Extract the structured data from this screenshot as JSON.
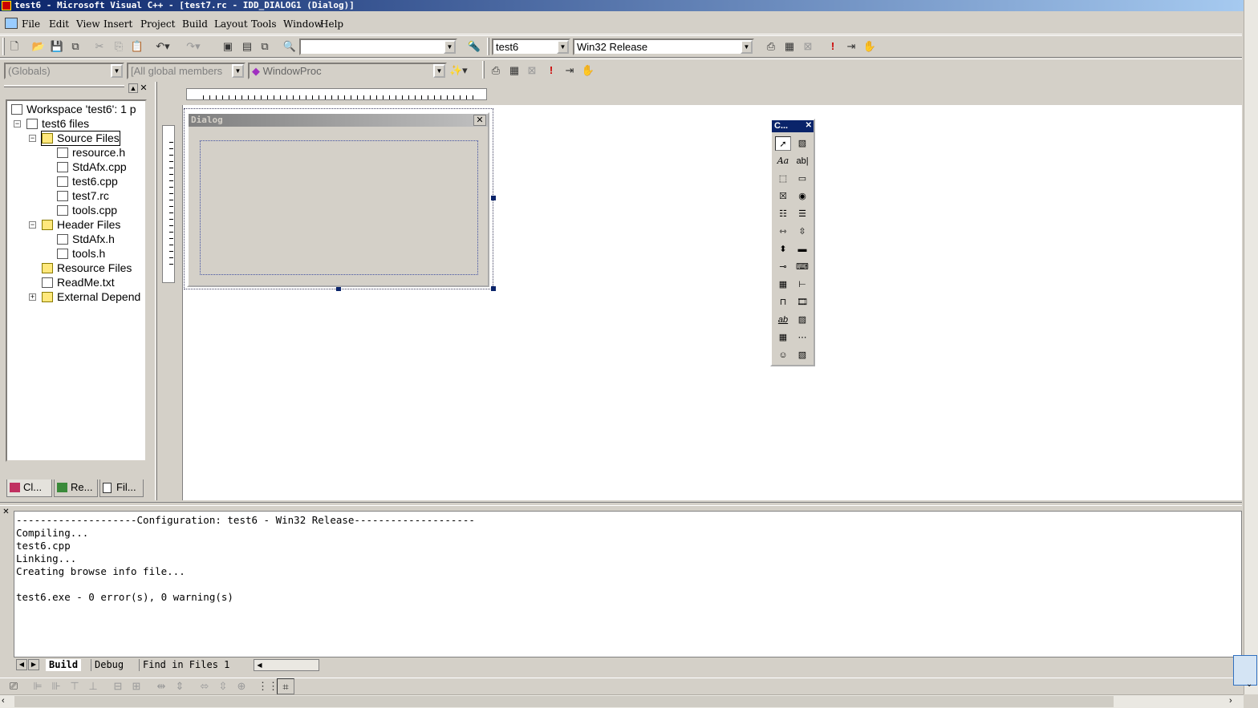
{
  "window": {
    "title": "test6 - Microsoft Visual C++ - [test7.rc - IDD_DIALOG1 (Dialog)]"
  },
  "menu": [
    "File",
    "Edit",
    "View",
    "Insert",
    "Project",
    "Build",
    "Layout",
    "Tools",
    "Window",
    "Help"
  ],
  "toolbar1": {
    "find_combo_value": "",
    "project_combo": "test6",
    "config_combo": "Win32 Release",
    "icons": [
      "new-file-icon",
      "open-icon",
      "save-icon",
      "save-all-icon",
      "cut-icon",
      "copy-icon",
      "paste-icon",
      "undo-icon",
      "redo-icon",
      "workspace-icon",
      "output-icon",
      "window-list-icon",
      "find-in-files-icon",
      "find-icon",
      "compile-icon",
      "build-icon",
      "stop-build-icon",
      "execute-icon",
      "go-icon",
      "breakpoint-icon"
    ]
  },
  "toolbar2": {
    "class_combo": "(Globals)",
    "members_combo": "[All global members",
    "function_combo": "WindowProc"
  },
  "workspace": {
    "root": "Workspace 'test6': 1 p",
    "project": "test6 files",
    "nodes": [
      "Source Files",
      "resource.h",
      "StdAfx.cpp",
      "test6.cpp",
      "test7.rc",
      "tools.cpp",
      "Header Files",
      "StdAfx.h",
      "tools.h",
      "Resource Files",
      "ReadMe.txt",
      "External Depend"
    ],
    "tabs": [
      "Cl...",
      "Re...",
      "Fil..."
    ]
  },
  "dialog": {
    "caption": "Dialog"
  },
  "controls_toolbox": {
    "caption": "C...",
    "tools": [
      "pointer",
      "picture",
      "Aa",
      "ab|",
      "group-box",
      "button",
      "check-box",
      "radio-button",
      "combo-box",
      "list-box",
      "h-scroll",
      "v-scroll",
      "spin",
      "progress",
      "slider",
      "hot-key",
      "list-control",
      "tree-control",
      "tab-control",
      "animate",
      "rich-edit",
      "date-time",
      "month-calendar",
      "ip-address",
      "custom-control",
      "extended-combo"
    ]
  },
  "output": {
    "lines": [
      "--------------------Configuration: test6 - Win32 Release--------------------",
      "Compiling...",
      "test6.cpp",
      "Linking...",
      "Creating browse info file...",
      "",
      "test6.exe - 0 error(s), 0 warning(s)"
    ],
    "tabs": [
      "Build",
      "Debug",
      "Find in Files 1"
    ]
  }
}
